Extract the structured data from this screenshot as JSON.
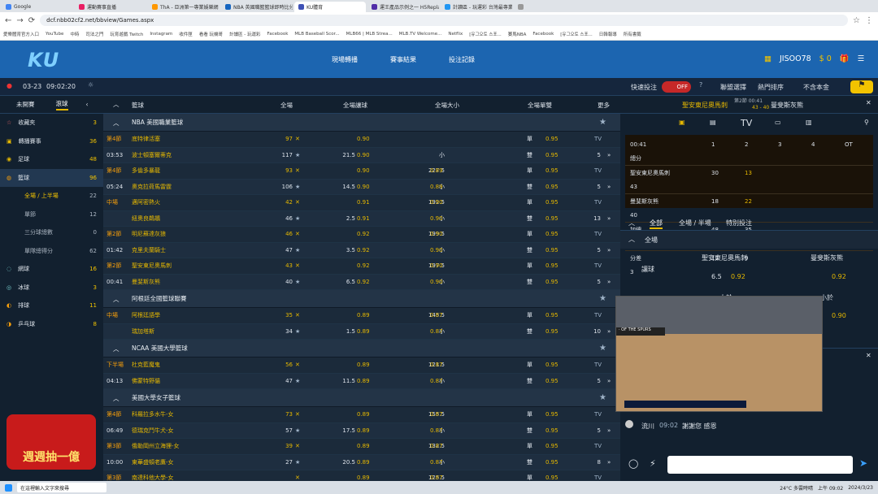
{
  "browser": {
    "tabs": [
      "Google",
      "運動賽事直播",
      "ThA - 亞洲第一專業娛樂網",
      "NBA 英國職籃籃球即時比分",
      "KU體育",
      "運王產品示例之一 H5Replay",
      "計讀區 - 玩運彩 台灣最專業",
      "+"
    ],
    "url": "dcf.nbb02cf2.net/bbview/Games.aspx",
    "bookmarks": [
      "愛樂體育官方入口",
      "YouTube",
      "中時",
      "司法之門",
      "玩育遊戲 Twitch",
      "Instagram",
      "收件匣",
      "看看 玩機哥",
      "計讀區 - 玩運彩",
      "Facebook",
      "MLB Baseball Scor...",
      "MLB66 | MLB Strea...",
      "MLB.TV Welcome...",
      "Netflix",
      "[유그오토 스포...",
      "賽馬NBA",
      "Facebook",
      "[유그오토 스포...",
      "日韓報導",
      "所有書籤"
    ]
  },
  "header": {
    "logo": "KU",
    "nav": [
      "現場轉播",
      "賽事結果",
      "投注記錄"
    ],
    "username": "JISOO78",
    "balance": "$ 0"
  },
  "toolbar": {
    "date": "03-23",
    "time": "09:02:20",
    "quick_bet": "快速投注",
    "quick_state": "OFF",
    "league_select": "聯盟選擇",
    "sort": "熱門排序",
    "principal": "不含本金"
  },
  "sidebar": {
    "tab_unstarted": "未開賽",
    "tab_live": "滾球",
    "items": [
      {
        "label": "收藏夾",
        "count": "3"
      },
      {
        "label": "轉播賽事",
        "count": "36"
      },
      {
        "label": "足球",
        "count": "48"
      },
      {
        "label": "籃球",
        "count": "96"
      }
    ],
    "subs": [
      {
        "label": "全場 / 上半場",
        "count": "22"
      },
      {
        "label": "單節",
        "count": "12"
      },
      {
        "label": "三分球總數",
        "count": "0"
      },
      {
        "label": "單隊總得分",
        "count": "62"
      }
    ],
    "items2": [
      {
        "label": "網球",
        "count": "16"
      },
      {
        "label": "冰球",
        "count": "3"
      },
      {
        "label": "排球",
        "count": "11"
      },
      {
        "label": "乒乓球",
        "count": "8"
      }
    ]
  },
  "columns": {
    "league": "籃球",
    "full": "全場",
    "handicap": "全場讓球",
    "ou": "全場大小",
    "oe": "全場單雙",
    "more": "更多"
  },
  "leagues": [
    {
      "name": "NBA 美國職業籃球",
      "games": [
        {
          "p1": "第4節",
          "p2": "03:53",
          "h": "底特律活塞",
          "a": "波士頓塞爾蒂克",
          "hs": "97",
          "as": "117",
          "hdp": "21.5",
          "o1": "0.90",
          "o2": "0.90",
          "ou": "",
          "u1": "",
          "u2": "",
          "oe1": "0.95",
          "oe2": "0.95",
          "more": "5"
        },
        {
          "p1": "第4節",
          "p2": "05:24",
          "h": "多倫多暴龍",
          "a": "奧克拉荷馬雷霆",
          "hs": "93",
          "as": "106",
          "hdp": "14.5",
          "o1": "0.90",
          "o2": "0.90",
          "ou": "227.5",
          "u1": "0.89",
          "u2": "0.89",
          "oe1": "0.95",
          "oe2": "0.95",
          "more": "5"
        },
        {
          "p1": "中場",
          "p2": "",
          "h": "邁阿密熱火",
          "a": "紐奧良鵜鶘",
          "hs": "42",
          "as": "46",
          "hdp": "2.5",
          "o1": "0.91",
          "o2": "0.91",
          "ou": "192.5",
          "u1": "0.90",
          "u2": "0.90",
          "oe1": "0.95",
          "oe2": "0.95",
          "more": "13"
        },
        {
          "p1": "第2節",
          "p2": "01:42",
          "h": "明尼蘇達灰狼",
          "a": "克里夫蘭騎士",
          "hs": "46",
          "as": "47",
          "hdp": "3.5",
          "o1": "0.92",
          "o2": "0.92",
          "ou": "199.5",
          "u1": "0.90",
          "u2": "0.90",
          "oe1": "0.95",
          "oe2": "0.95",
          "more": "5"
        },
        {
          "p1": "第2節",
          "p2": "00:41",
          "h": "聖安東尼奧馬刺",
          "a": "曼斐斯灰熊",
          "hs": "43",
          "as": "40",
          "hdp": "6.5",
          "o1": "0.92",
          "o2": "0.92",
          "ou": "197.5",
          "u1": "0.90",
          "u2": "0.90",
          "oe1": "0.95",
          "oe2": "0.95",
          "more": "5"
        }
      ]
    },
    {
      "name": "阿根廷全國籃球聯賽",
      "games": [
        {
          "p1": "中場",
          "p2": "",
          "h": "阿根廷語學",
          "a": "瑞加塔斯",
          "hs": "35",
          "as": "34",
          "hdp": "1.5",
          "o1": "0.89",
          "o2": "0.89",
          "ou": "145.5",
          "u1": "0.87",
          "u2": "0.87",
          "oe1": "0.95",
          "oe2": "0.95",
          "more": "10"
        }
      ]
    },
    {
      "name": "NCAA 美國大學籃球",
      "games": [
        {
          "p1": "下半場",
          "p2": "04:13",
          "h": "杜克藍魔鬼",
          "a": "佛蒙特野貓",
          "hs": "56",
          "as": "47",
          "hdp": "11.5",
          "o1": "0.89",
          "o2": "0.89",
          "ou": "121.5",
          "u1": "0.87",
          "u2": "0.87",
          "oe1": "0.95",
          "oe2": "0.95",
          "more": "5"
        }
      ]
    },
    {
      "name": "美國大學女子籃球",
      "games": [
        {
          "p1": "第4節",
          "p2": "06:49",
          "h": "科羅拉多水牛-女",
          "a": "德瑞克鬥牛犬-女",
          "hs": "73",
          "as": "57",
          "hdp": "17.5",
          "o1": "0.89",
          "o2": "0.89",
          "ou": "155.5",
          "u1": "0.87",
          "u2": "0.87",
          "oe1": "0.95",
          "oe2": "0.95",
          "more": "5"
        },
        {
          "p1": "第3節",
          "p2": "10:00",
          "h": "俄勒岡州立海狸-女",
          "a": "東華盛頓老鷹-女",
          "hs": "39",
          "as": "27",
          "hdp": "20.5",
          "o1": "0.89",
          "o2": "0.89",
          "ou": "132.5",
          "u1": "0.87",
          "u2": "0.87",
          "oe1": "0.95",
          "oe2": "0.95",
          "more": "8"
        },
        {
          "p1": "第3節",
          "p2": "",
          "h": "南達科他大學-女",
          "a": "",
          "hs": "",
          "as": "",
          "hdp": "9.5",
          "o1": "0.89",
          "o2": "",
          "ou": "125.5",
          "u1": "0.87",
          "u2": "",
          "oe1": "0.95",
          "oe2": "",
          "more": ""
        }
      ]
    }
  ],
  "labels": {
    "big": "大",
    "small": "小",
    "odd": "單",
    "even": "雙",
    "tv": "TV"
  },
  "right": {
    "home": "聖安東尼奧馬刺",
    "away": "曼斐斯灰熊",
    "period": "第2節 00:41",
    "score": "43 - 40",
    "sb_time": "00:41",
    "sb_head": [
      "1",
      "2",
      "3",
      "4",
      "OT",
      "總分"
    ],
    "sb_rows": [
      {
        "t": "聖安東尼奧馬刺",
        "v": [
          "30",
          "13",
          "",
          "",
          "",
          "43"
        ]
      },
      {
        "t": "曼斐斯灰熊",
        "v": [
          "18",
          "22",
          "",
          "",
          "",
          "40"
        ]
      },
      {
        "t": "加總",
        "v": [
          "48",
          "35",
          "",
          "",
          "",
          "83"
        ]
      },
      {
        "t": "分差",
        "v": [
          "12",
          "9",
          "",
          "",
          "",
          "3"
        ]
      }
    ],
    "tabs": [
      "全部",
      "全場 / 半場",
      "特別投注"
    ],
    "section": "全場",
    "market": "讓球",
    "line": "6.5",
    "odd_home": "0.92",
    "odd_away": "0.92",
    "big": "大於",
    "small": "小於",
    "small_odd": "0.90",
    "chat_user": "流川",
    "chat_time": "09:02",
    "chat_msg": "謝謝您 感恩"
  },
  "promo": "週週抽一億",
  "taskbar": {
    "search": "在這裡輸入文字來搜尋",
    "weather": "24°C 多雲時晴",
    "clock": "上午 09:02",
    "date": "2024/3/23"
  }
}
